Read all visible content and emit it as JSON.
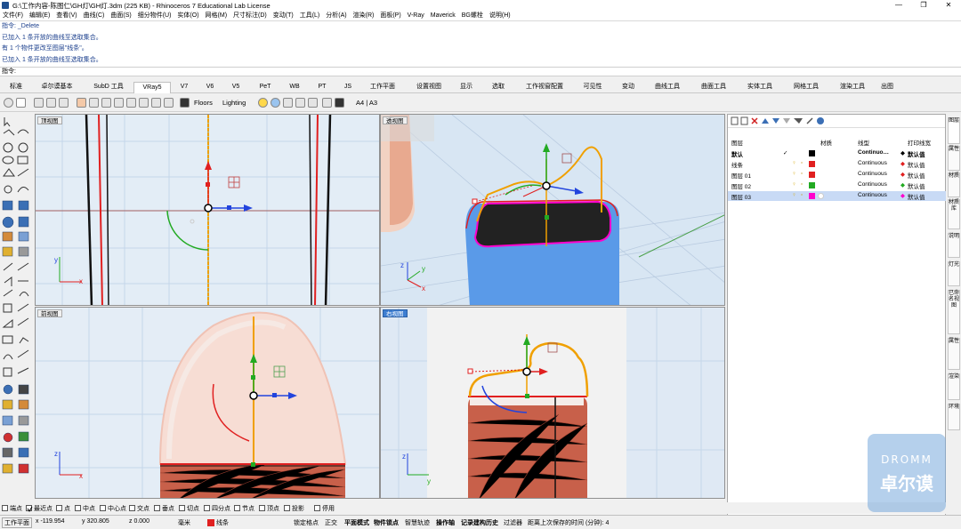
{
  "window": {
    "title": "G:\\工作内容-陈图仁\\GH灯\\GH灯.3dm (225 KB) - Rhinoceros 7 Educational Lab License",
    "buttons": [
      "—",
      "❐",
      "✕"
    ]
  },
  "menu": [
    "文件(F)",
    "编辑(E)",
    "查看(V)",
    "曲线(C)",
    "曲面(S)",
    "细分物件(U)",
    "实体(O)",
    "网格(M)",
    "尺寸标注(D)",
    "变动(T)",
    "工具(L)",
    "分析(A)",
    "渲染(R)",
    "面板(P)",
    "V-Ray",
    "Maverick",
    "BG螺栓",
    "说明(H)"
  ],
  "command_history": [
    "指令: _Delete",
    "已加入 1 条开放的曲线至选取集合。",
    "有 1 个物件更改至图层\"线条\"。",
    "已加入 1 条开放的曲线至选取集合。"
  ],
  "command_prompt": "指令:",
  "tabs": [
    "标准",
    "卓尔谟基本",
    "SubD 工具",
    "VRay5",
    "V7",
    "V6",
    "V5",
    "PeT",
    "WB",
    "PT",
    "JS",
    "工作平面",
    "设置视图",
    "显示",
    "选取",
    "工作视窗配置",
    "可见性",
    "变动",
    "曲线工具",
    "曲面工具",
    "实体工具",
    "网格工具",
    "渲染工具",
    "出图"
  ],
  "active_tab": "VRay5",
  "vray_toolbar": {
    "floors": "Floors",
    "lighting": "Lighting",
    "paper": "A4 | A3"
  },
  "viewports": {
    "top": "顶视图",
    "perspective": "透视图",
    "front": "前视图",
    "right": "右视图"
  },
  "axes": {
    "x": "x",
    "y": "y",
    "z": "z"
  },
  "layers": {
    "headers": {
      "name": "图层",
      "material": "材质",
      "linetype": "线型",
      "print_color": "打印线宽"
    },
    "rows": [
      {
        "name": "默认",
        "check": "✓",
        "color": "#000000",
        "linetype": "Continuo…",
        "print": "默认值",
        "print_color": "#000000",
        "bold": true
      },
      {
        "name": "线条",
        "color": "#e02020",
        "linetype": "Continuous",
        "print": "默认值",
        "print_color": "#e02020"
      },
      {
        "name": "图层 01",
        "color": "#e02020",
        "linetype": "Continuous",
        "print": "默认值",
        "print_color": "#e02020"
      },
      {
        "name": "图层 02",
        "color": "#22aa22",
        "linetype": "Continuous",
        "print": "默认值",
        "print_color": "#22aa22"
      },
      {
        "name": "图层 03",
        "color": "#ff00cc",
        "linetype": "Continuous",
        "print": "默认值",
        "print_color": "#ff00cc",
        "selected": true
      }
    ]
  },
  "right_tabs": [
    "图层",
    "属性",
    "材质",
    "材质库",
    "说明",
    "灯光",
    "已命名视图",
    "属性",
    "渲染",
    "环境"
  ],
  "osnaps": [
    {
      "label": "端点",
      "checked": false
    },
    {
      "label": "最近点",
      "checked": true
    },
    {
      "label": "点",
      "checked": false
    },
    {
      "label": "中点",
      "checked": false
    },
    {
      "label": "中心点",
      "checked": false
    },
    {
      "label": "交点",
      "checked": false
    },
    {
      "label": "垂点",
      "checked": false
    },
    {
      "label": "切点",
      "checked": false
    },
    {
      "label": "四分点",
      "checked": false
    },
    {
      "label": "节点",
      "checked": false
    },
    {
      "label": "顶点",
      "checked": false
    },
    {
      "label": "投影",
      "checked": false
    },
    {
      "label": "停用",
      "checked": false
    }
  ],
  "status": {
    "cplane": "工作平面",
    "x": "x -119.954",
    "y": "y 320.805",
    "z": "z 0.000",
    "unit": "毫米",
    "layer": "线条",
    "layer_color": "#e02020",
    "items": [
      "锁定格点",
      "正交",
      "平面模式",
      "物件锁点",
      "智慧轨迹",
      "操作轴",
      "记录建构历史",
      "过滤器"
    ],
    "bold_items": [
      "平面模式",
      "物件锁点",
      "操作轴",
      "记录建构历史"
    ],
    "save_info": "距离上次保存的时间 (分钟): 4"
  },
  "watermark": {
    "en": "DROMM",
    "cn": "卓尔谟"
  }
}
